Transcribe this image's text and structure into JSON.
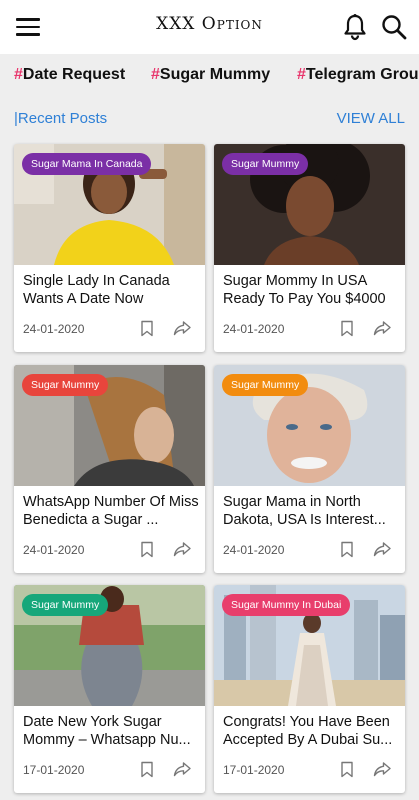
{
  "header": {
    "title": "XXX Option",
    "menu_icon": "hamburger-menu-icon",
    "bell_icon": "bell-icon",
    "search_icon": "search-icon"
  },
  "tags": [
    {
      "hash": "#",
      "label": "Date Request"
    },
    {
      "hash": "#",
      "label": "Sugar Mummy"
    },
    {
      "hash": "#",
      "label": "Telegram Group"
    }
  ],
  "section": {
    "title": "|Recent Posts",
    "view_all": "VIEW ALL"
  },
  "colors": {
    "accent_blue": "#2f80d6",
    "hash_pink": "#e8356c"
  },
  "posts": [
    {
      "badge": "Sugar Mama In Canada",
      "badge_color": "#7b2fa6",
      "title": "Single Lady In Canada Wants A Date Now",
      "date": "24-01-2020"
    },
    {
      "badge": "Sugar Mummy",
      "badge_color": "#7b2fa6",
      "title": "Sugar Mommy In USA Ready To Pay You $4000",
      "date": "24-01-2020"
    },
    {
      "badge": "Sugar Mummy",
      "badge_color": "#e8453c",
      "title": "WhatsApp Number Of Miss Benedicta a Sugar ...",
      "date": "24-01-2020"
    },
    {
      "badge": "Sugar Mummy",
      "badge_color": "#f28c0f",
      "title": "Sugar Mama in North Dakota, USA Is Interest...",
      "date": "24-01-2020"
    },
    {
      "badge": "Sugar Mummy",
      "badge_color": "#16a77a",
      "title": "Date New York Sugar Mommy – Whatsapp Nu...",
      "date": "17-01-2020"
    },
    {
      "badge": "Sugar Mummy In Dubai",
      "badge_color": "#e83e6c",
      "title": "Congrats! You Have Been Accepted By A Dubai Su...",
      "date": "17-01-2020"
    }
  ]
}
